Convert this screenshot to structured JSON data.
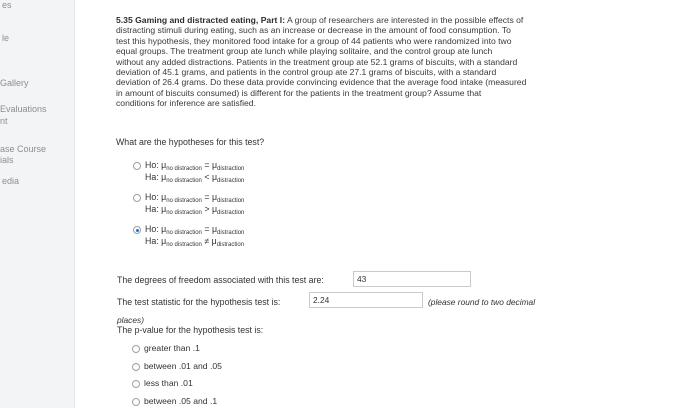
{
  "sidebar": {
    "items": [
      "es",
      "le",
      "Gallery",
      "Evaluations",
      "nt",
      "ase Course",
      "ials",
      "edia"
    ]
  },
  "problem": {
    "title": "5.35 Gaming and distracted eating, Part I:",
    "lines": [
      "A group of researchers are interested in the possible effects of",
      "distracting stimuli during eating, such as an increase or decrease in the amount of food consumption. To",
      "test this hypothesis, they monitored food intake for a group of 44 patients who were randomized into two",
      "equal groups. The treatment group ate lunch while playing solitaire, and the control group ate lunch",
      "without any added distractions. Patients in the treatment group ate 52.1 grams of biscuits, with a standard",
      "deviation of 45.1 grams, and patients in the control group ate 27.1 grams of biscuits, with a standard",
      "deviation of 26.4 grams. Do these data provide convincing evidence that the average food intake (measured",
      "in amount of biscuits consumed) is different for the patients in the treatment group? Assume that",
      "conditions for inference are satisfied."
    ]
  },
  "hypotheses": {
    "question": "What are the hypotheses for this test?",
    "options": [
      {
        "h0_prefix": "Ho: μ",
        "h0_sub1": "no distraction",
        "h0_op": "=",
        "h0_mu2": "μ",
        "h0_sub2": "distraction",
        "ha_prefix": "Ha: μ",
        "ha_sub1": "no distraction",
        "ha_op": "<",
        "ha_mu2": "μ",
        "ha_sub2": "distraction"
      },
      {
        "h0_prefix": "Ho: μ",
        "h0_sub1": "no distraction",
        "h0_op": "=",
        "h0_mu2": "μ",
        "h0_sub2": "distraction",
        "ha_prefix": "Ha: μ",
        "ha_sub1": "no distraction",
        "ha_op": ">",
        "ha_mu2": "μ",
        "ha_sub2": "distraction"
      },
      {
        "h0_prefix": "Ho: μ",
        "h0_sub1": "no distraction",
        "h0_op": "=",
        "h0_mu2": "μ",
        "h0_sub2": "distraction",
        "ha_prefix": "Ha: μ",
        "ha_sub1": "no distraction",
        "ha_op": "≠",
        "ha_mu2": "μ",
        "ha_sub2": "distraction"
      }
    ],
    "selected_index": 2
  },
  "df": {
    "label": "The degrees of freedom associated with this test are:",
    "value": "43"
  },
  "test_stat": {
    "label": "The test statistic for the hypothesis test is:",
    "value": "2.24",
    "note_part1": "(please round to two decimal",
    "note_part2": "places)"
  },
  "pvalue": {
    "label": "The p-value for the hypothesis test is:",
    "options": [
      "greater than .1",
      "between .01 and .05",
      "less than .01",
      "between .05 and .1"
    ]
  },
  "colors": {
    "accent": "#1d6fd1",
    "sidebar_bg": "#f3f4f6"
  }
}
